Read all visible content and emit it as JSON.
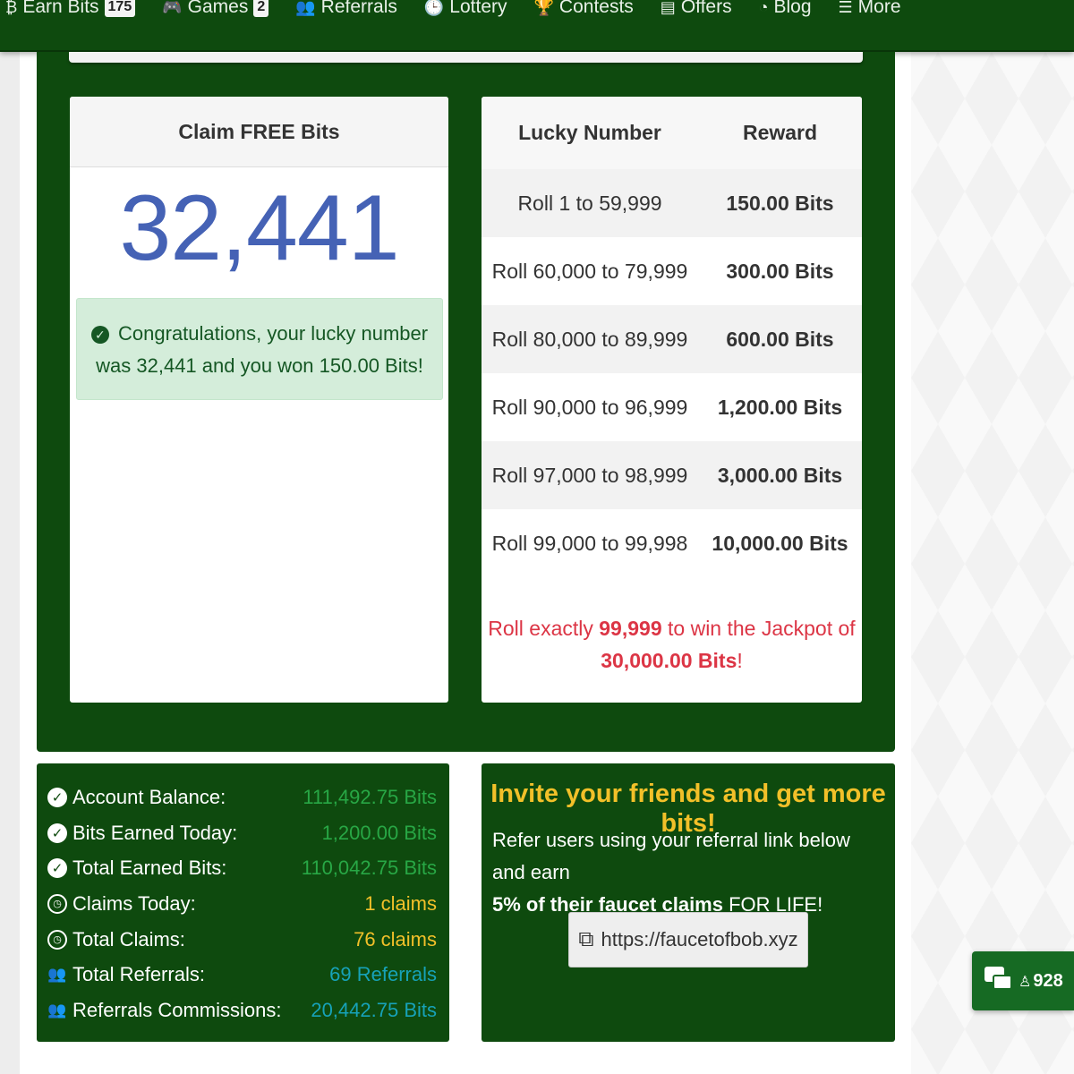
{
  "nav": {
    "items": [
      {
        "icon": "bitcoin-icon",
        "glyph": "₿",
        "label": "Earn Bits",
        "badge": "175"
      },
      {
        "icon": "gamepad-icon",
        "glyph": "🎮",
        "label": "Games",
        "badge": "2"
      },
      {
        "icon": "users-icon",
        "glyph": "👥",
        "label": "Referrals",
        "badge": ""
      },
      {
        "icon": "clock-icon",
        "glyph": "🕒",
        "label": "Lottery",
        "badge": ""
      },
      {
        "icon": "trophy-icon",
        "glyph": "🏆",
        "label": "Contests",
        "badge": ""
      },
      {
        "icon": "list-icon",
        "glyph": "▤",
        "label": "Offers",
        "badge": ""
      },
      {
        "icon": "rss-icon",
        "glyph": "◔",
        "label": "Blog",
        "badge": ""
      },
      {
        "icon": "menu-icon",
        "glyph": "☰",
        "label": "More",
        "badge": ""
      }
    ]
  },
  "claim": {
    "title": "Claim FREE Bits",
    "lucky_number": "32,441",
    "message_line1": "Congratulations, your lucky number",
    "message_line2": "was 32,441 and you won 150.00 Bits!"
  },
  "rewards": {
    "header_number": "Lucky Number",
    "header_reward": "Reward",
    "rows": [
      {
        "range": "Roll 1 to 59,999",
        "reward": "150.00 Bits"
      },
      {
        "range": "Roll 60,000 to 79,999",
        "reward": "300.00 Bits"
      },
      {
        "range": "Roll 80,000 to 89,999",
        "reward": "600.00 Bits"
      },
      {
        "range": "Roll 90,000 to 96,999",
        "reward": "1,200.00 Bits"
      },
      {
        "range": "Roll 97,000 to 98,999",
        "reward": "3,000.00 Bits"
      },
      {
        "range": "Roll 99,000 to 99,998",
        "reward": "10,000.00 Bits"
      }
    ],
    "jackpot_prefix": "Roll exactly ",
    "jackpot_number": "99,999",
    "jackpot_middle": " to win the Jackpot of",
    "jackpot_amount": "30,000.00 Bits",
    "jackpot_suffix": "!"
  },
  "stats": [
    {
      "icon": "check-circle-icon",
      "label": "Account Balance:",
      "value": "111,492.75 Bits",
      "color": "#28a745"
    },
    {
      "icon": "check-circle-icon",
      "label": "Bits Earned Today:",
      "value": "1,200.00 Bits",
      "color": "#28a745"
    },
    {
      "icon": "check-circle-icon",
      "label": "Total Earned Bits:",
      "value": "110,042.75 Bits",
      "color": "#28a745"
    },
    {
      "icon": "clock-icon",
      "label": "Claims Today:",
      "value": "1 claims",
      "color": "#f2c029"
    },
    {
      "icon": "clock-icon",
      "label": "Total Claims:",
      "value": "76 claims",
      "color": "#f2c029"
    },
    {
      "icon": "users-icon",
      "label": "Total Referrals:",
      "value": "69 Referrals",
      "color": "#17a2b8"
    },
    {
      "icon": "users-icon",
      "label": "Referrals Commissions:",
      "value": "20,442.75 Bits",
      "color": "#17a2b8"
    }
  ],
  "invite": {
    "title": "Invite your friends and get more bits!",
    "text_line1": "Refer users using your referral link below and earn",
    "text_bold": "5% of their faucet claims",
    "text_end": " FOR LIFE!",
    "link": "https://faucetofbob.xyz"
  },
  "chat": {
    "online_count": "928"
  }
}
